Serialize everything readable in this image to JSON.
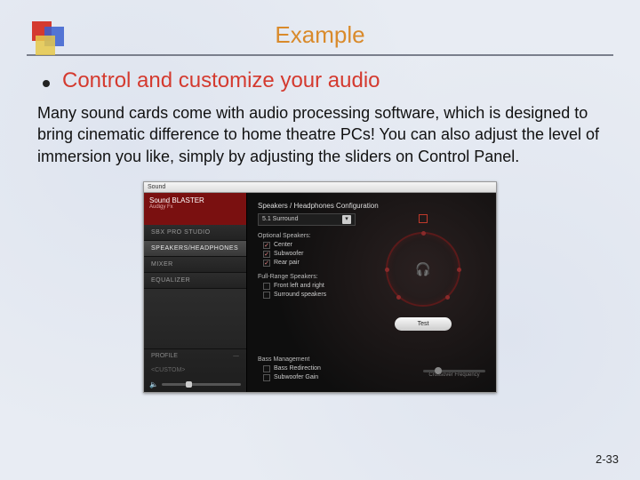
{
  "slide": {
    "title": "Example",
    "bullet": "Control and customize your audio",
    "body": "Many sound cards come with audio processing software, which is designed to bring cinematic difference to home theatre PCs! You can also adjust the level of immersion you like, simply by adjusting the sliders on Control Panel.",
    "page": "2-33"
  },
  "app": {
    "window_title": "Sound",
    "brand_line1": "Sound BLASTER",
    "brand_line2": "Audigy Fx",
    "sidebar": {
      "items": [
        {
          "label": "SBX PRO STUDIO"
        },
        {
          "label": "SPEAKERS/HEADPHONES"
        },
        {
          "label": "MIXER"
        },
        {
          "label": "EQUALIZER"
        }
      ],
      "profile": "PROFILE",
      "custom": "<CUSTOM>"
    },
    "main": {
      "config_label": "Speakers / Headphones Configuration",
      "dropdown_value": "5.1 Surround",
      "optional_label": "Optional Speakers:",
      "optional": [
        {
          "label": "Center",
          "checked": true
        },
        {
          "label": "Subwoofer",
          "checked": true
        },
        {
          "label": "Rear pair",
          "checked": true
        }
      ],
      "fullrange_label": "Full-Range Speakers:",
      "fullrange": [
        {
          "label": "Front left and right",
          "checked": false
        },
        {
          "label": "Surround speakers",
          "checked": false
        }
      ],
      "bass_label": "Bass Management",
      "bass": [
        {
          "label": "Bass Redirection",
          "checked": false
        },
        {
          "label": "Subwoofer Gain",
          "checked": false
        }
      ],
      "test_label": "Test",
      "crossover_label": "Crossover Frequency"
    }
  }
}
